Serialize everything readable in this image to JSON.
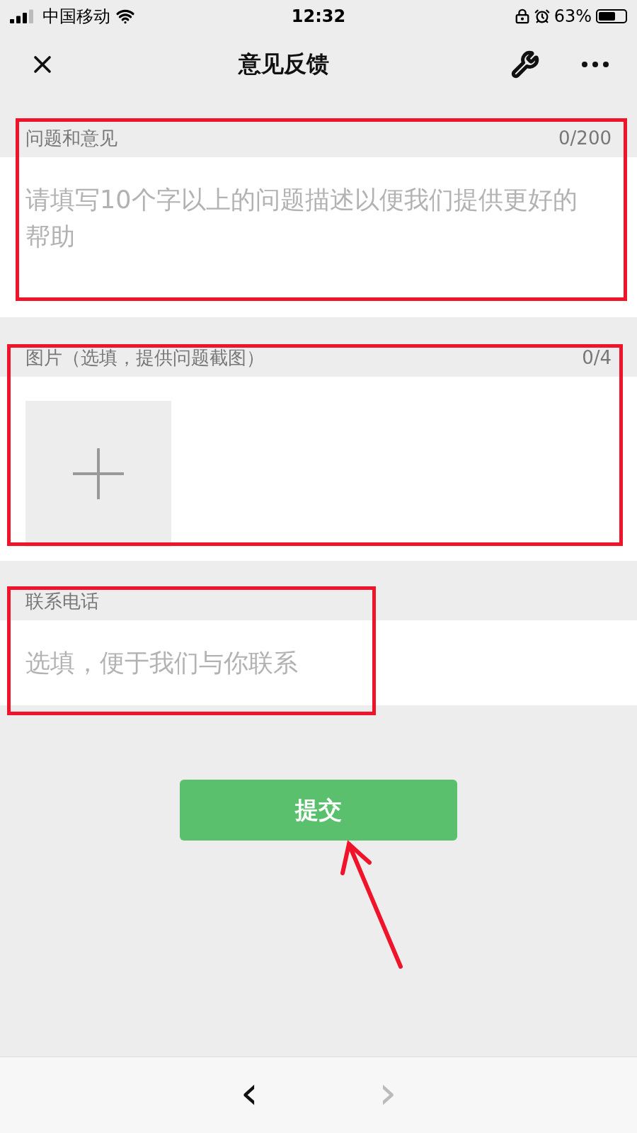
{
  "status_bar": {
    "carrier": "中国移动",
    "time": "12:32",
    "battery_text": "63%",
    "battery": {
      "level": 0.63
    }
  },
  "nav": {
    "title": "意见反馈"
  },
  "sections": [
    {
      "kind": "text",
      "label": "问题和意见",
      "count": "0/200",
      "placeholder": "请填写10个字以上的问题描述以便我们提供更好的帮助"
    },
    {
      "kind": "images",
      "label": "图片（选填，提供问题截图）",
      "count": "0/4"
    },
    {
      "kind": "phone",
      "label": "联系电话",
      "placeholder": "选填，便于我们与你联系"
    }
  ],
  "submit": {
    "label": "提交"
  },
  "toolbar": {
    "back": {
      "label": "‹",
      "disabled": false
    },
    "forward": {
      "label": "›",
      "disabled": true
    }
  },
  "annotations": [
    {
      "kind": "box"
    },
    {
      "kind": "box"
    },
    {
      "kind": "box"
    },
    {
      "kind": "arrow"
    }
  ]
}
